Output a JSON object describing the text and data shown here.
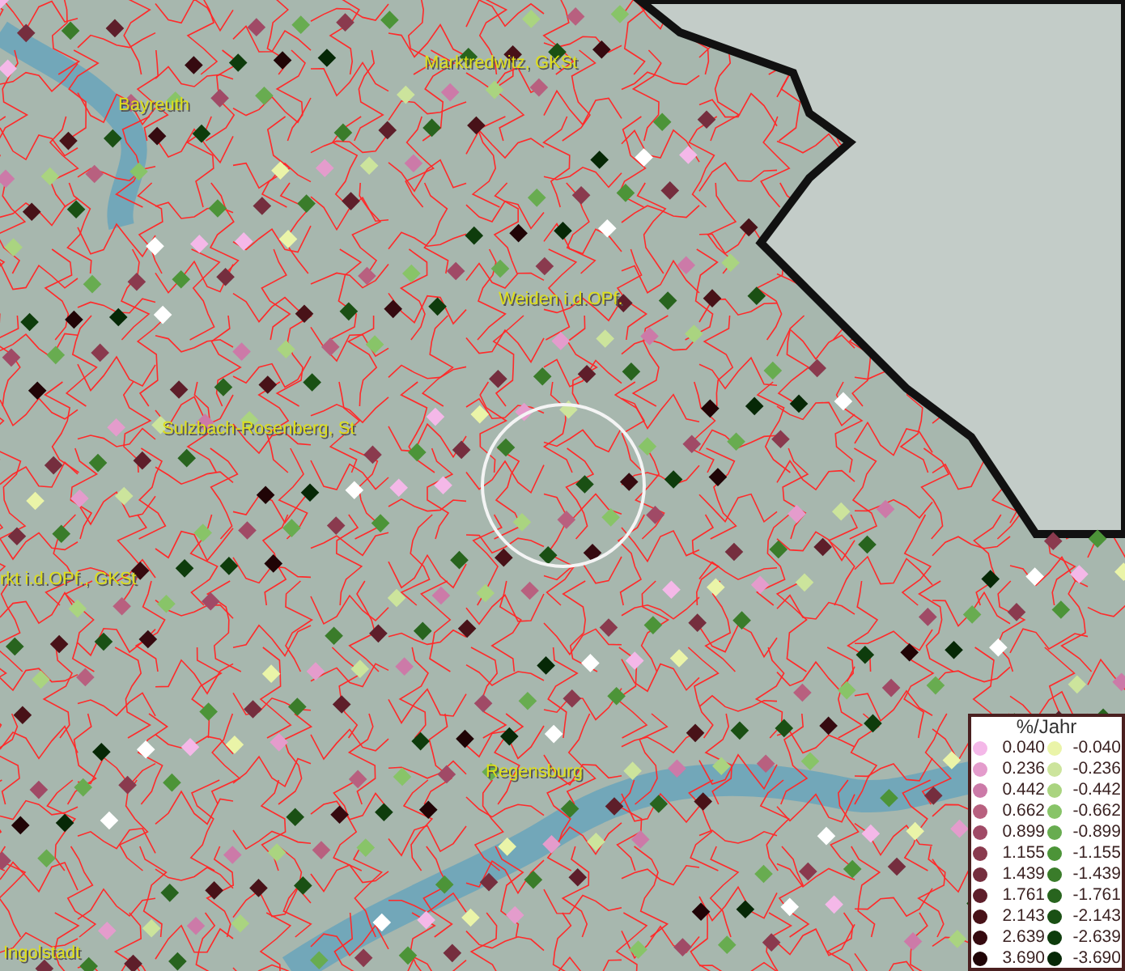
{
  "map": {
    "labels": [
      {
        "text": "Marktredwitz, GKSt"
      },
      {
        "text": "Bayreuth"
      },
      {
        "text": "Weiden i.d.OPf."
      },
      {
        "text": "Sulzbach-Rosenberg, St"
      },
      {
        "text": "rkt i.d.OPf., GKSt"
      },
      {
        "text": "Regensburg"
      },
      {
        "text": "Ingolstadt"
      }
    ]
  },
  "legend": {
    "title": "%/Jahr",
    "rows": [
      {
        "positive": {
          "value": "0.040",
          "color": "#f4b8e8"
        },
        "negative": {
          "value": "-0.040",
          "color": "#eaf4a8"
        }
      },
      {
        "positive": {
          "value": "0.236",
          "color": "#e49ccc"
        },
        "negative": {
          "value": "-0.236",
          "color": "#cce49c"
        }
      },
      {
        "positive": {
          "value": "0.442",
          "color": "#cc7aa8"
        },
        "negative": {
          "value": "-0.442",
          "color": "#aad480"
        }
      },
      {
        "positive": {
          "value": "0.662",
          "color": "#b8607f"
        },
        "negative": {
          "value": "-0.662",
          "color": "#88c468"
        }
      },
      {
        "positive": {
          "value": "0.899",
          "color": "#a04a66"
        },
        "negative": {
          "value": "-0.899",
          "color": "#68ac50"
        }
      },
      {
        "positive": {
          "value": "1.155",
          "color": "#8a3a4e"
        },
        "negative": {
          "value": "-1.155",
          "color": "#4c9438"
        }
      },
      {
        "positive": {
          "value": "1.439",
          "color": "#752e3e"
        },
        "negative": {
          "value": "-1.439",
          "color": "#3a7c2a"
        }
      },
      {
        "positive": {
          "value": "1.761",
          "color": "#5e1e2a"
        },
        "negative": {
          "value": "-1.761",
          "color": "#28641e"
        }
      },
      {
        "positive": {
          "value": "2.143",
          "color": "#481218"
        },
        "negative": {
          "value": "-2.143",
          "color": "#1a5014"
        }
      },
      {
        "positive": {
          "value": "2.639",
          "color": "#360a10"
        },
        "negative": {
          "value": "-2.639",
          "color": "#0e3c0c"
        }
      },
      {
        "positive": {
          "value": "3.690",
          "color": "#200406"
        },
        "negative": {
          "value": "-3.690",
          "color": "#062806"
        }
      }
    ]
  }
}
